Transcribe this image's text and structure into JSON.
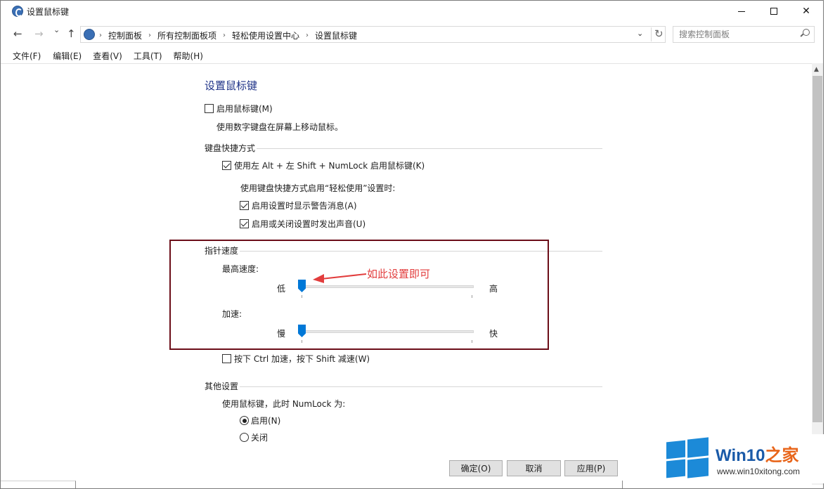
{
  "window": {
    "title": "设置鼠标键",
    "minimize_glyph": "",
    "close_glyph": "✕"
  },
  "nav": {
    "back": "←",
    "forward": "→",
    "recent": "⌄",
    "up": "↑",
    "breadcrumbs": [
      "控制面板",
      "所有控制面板项",
      "轻松使用设置中心",
      "设置鼠标键"
    ],
    "separator": "›",
    "dropdown": "⌄",
    "refresh": "↻",
    "search_placeholder": "搜索控制面板"
  },
  "menu": [
    "文件(F)",
    "编辑(E)",
    "查看(V)",
    "工具(T)",
    "帮助(H)"
  ],
  "main": {
    "title": "设置鼠标键",
    "enable_mouse_keys": {
      "label": "启用鼠标键(M)",
      "checked": false
    },
    "enable_desc": "使用数字键盘在屏幕上移动鼠标。",
    "keyboard_shortcut": {
      "heading": "键盘快捷方式",
      "shortcut": {
        "label": "使用左 Alt + 左 Shift + NumLock 启用鼠标键(K)",
        "checked": true
      },
      "subheading": "使用键盘快捷方式启用“轻松使用”设置时:",
      "warn": {
        "label": "启用设置时显示警告消息(A)",
        "checked": true
      },
      "sound": {
        "label": "启用或关闭设置时发出声音(U)",
        "checked": true
      }
    },
    "pointer_speed": {
      "heading": "指针速度",
      "top_speed": {
        "label": "最高速度:",
        "low": "低",
        "high": "高",
        "value": 0.0
      },
      "acceleration": {
        "label": "加速:",
        "low": "慢",
        "high": "快",
        "value": 0.0
      },
      "ctrl_shift": {
        "label": "按下 Ctrl 加速，按下 Shift 减速(W)",
        "checked": false
      }
    },
    "other": {
      "heading": "其他设置",
      "numlock_label": "使用鼠标键，此时 NumLock 为:",
      "on": {
        "label": "启用(N)",
        "checked": true
      },
      "off": {
        "label": "关闭",
        "checked": false
      }
    },
    "annotation": "如此设置即可"
  },
  "buttons": {
    "ok": "确定(O)",
    "cancel": "取消",
    "apply": "应用(P)"
  },
  "watermark": {
    "brand": "Win10",
    "brand_zh": "之家",
    "url": "www.win10xitong.com"
  },
  "colors": {
    "accent": "#0078d7",
    "title": "#1e3287",
    "annotation": "#e23d3d",
    "highlight_border": "#6b0d18"
  }
}
